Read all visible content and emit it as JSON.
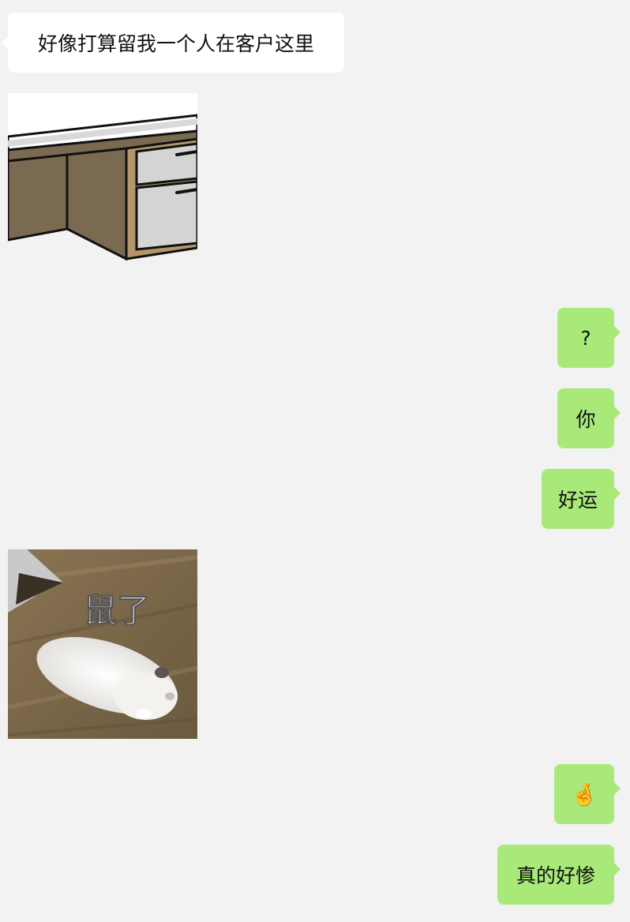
{
  "messages": [
    {
      "from": "other",
      "type": "text",
      "text": "好像打算留我一个人在客户这里"
    },
    {
      "from": "other",
      "type": "sticker",
      "sticker": "desk-sticker"
    },
    {
      "from": "me",
      "type": "text",
      "text": "?"
    },
    {
      "from": "me",
      "type": "text",
      "text": "你"
    },
    {
      "from": "me",
      "type": "text",
      "text": "好运"
    },
    {
      "from": "other",
      "type": "sticker",
      "sticker": "hamster-sticker",
      "caption": "鼠了"
    },
    {
      "from": "me",
      "type": "emoji",
      "text": "🤞"
    },
    {
      "from": "me",
      "type": "text",
      "text": "真的好惨"
    }
  ],
  "colors": {
    "background": "#f2f2f2",
    "incoming_bubble": "#ffffff",
    "outgoing_bubble": "#a9e97a"
  }
}
